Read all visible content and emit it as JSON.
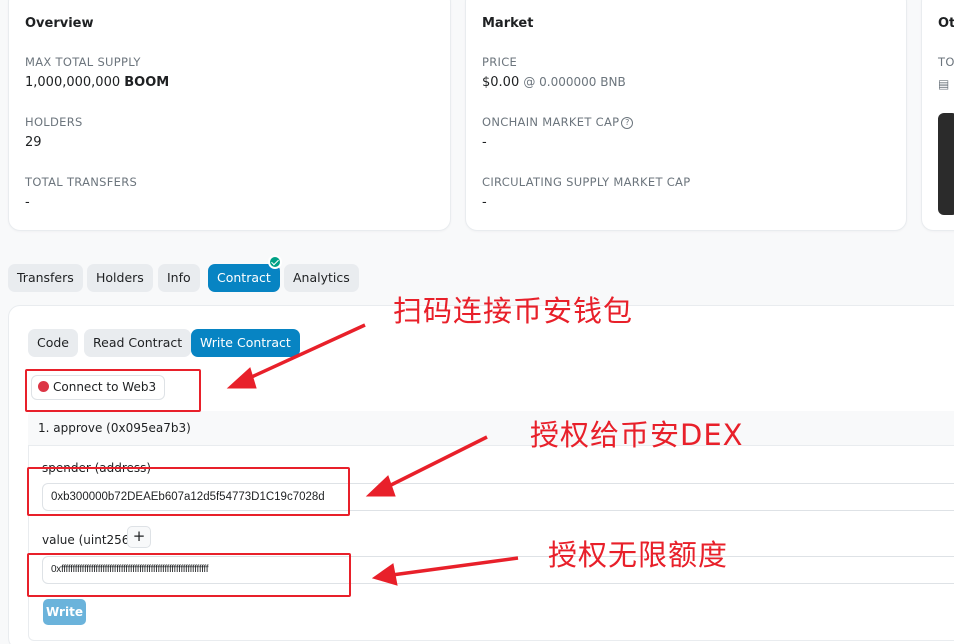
{
  "overview": {
    "title": "Overview",
    "max_supply_label": "MAX TOTAL SUPPLY",
    "max_supply_value": "1,000,000,000",
    "max_supply_symbol": "BOOM",
    "holders_label": "HOLDERS",
    "holders_value": "29",
    "transfers_label": "TOTAL TRANSFERS",
    "transfers_value": "-"
  },
  "market": {
    "title": "Market",
    "price_label": "PRICE",
    "price_value": "$0.00",
    "price_bnb": "@ 0.000000 BNB",
    "mcap_label": "ONCHAIN MARKET CAP",
    "mcap_value": "-",
    "circ_label": "CIRCULATING SUPPLY MARKET CAP",
    "circ_value": "-"
  },
  "other": {
    "title": "Ot",
    "label": "TO"
  },
  "tabs": [
    "Transfers",
    "Holders",
    "Info",
    "Contract",
    "Analytics"
  ],
  "subtabs": [
    "Code",
    "Read Contract",
    "Write Contract"
  ],
  "connect_label": "Connect to Web3",
  "function": {
    "header": "1. approve (0x095ea7b3)",
    "spender_label": "spender (address)",
    "spender_value": "0xb300000b72DEAEb607a12d5f54773D1C19c7028d",
    "value_label": "value (uint256)",
    "value_value": "0xffffffffffffffffffffffffffffffffffffffffffffffffffffffffffffffff",
    "plus": "+",
    "write_label": "Write"
  },
  "annotations": {
    "a1": "扫码连接币安钱包",
    "a2": "授权给币安DEX",
    "a3": "授权无限额度"
  },
  "colors": {
    "accent": "#0784c3",
    "annotation": "#e8202a",
    "status_dot": "#dc3545",
    "verified": "#00a186"
  }
}
